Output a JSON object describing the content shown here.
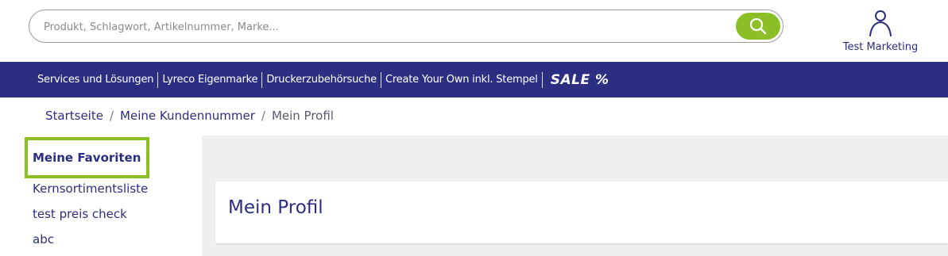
{
  "search": {
    "placeholder": "Produkt, Schlagwort, Artikelnummer, Marke...",
    "icon": "search-icon"
  },
  "user": {
    "name": "Test Marketing",
    "icon": "user-icon"
  },
  "nav": {
    "items": [
      {
        "label": "Services und Lösungen"
      },
      {
        "label": "Lyreco Eigenmarke"
      },
      {
        "label": "Druckerzubehörsuche"
      },
      {
        "label": "Create Your Own inkl. Stempel"
      }
    ],
    "sale_label": "SALE %"
  },
  "breadcrumb": {
    "items": [
      "Startseite",
      "Meine Kundennummer",
      "Mein Profil"
    ],
    "separator": "/"
  },
  "sidebar": {
    "active": "Meine Favoriten",
    "items": [
      "Kernsortimentsliste",
      "test preis check",
      "abc"
    ]
  },
  "main": {
    "title": "Mein Profil"
  },
  "colors": {
    "brand_blue": "#2c2e82",
    "accent_green": "#8cbf26",
    "text_blue": "#2b2e7e",
    "content_bg": "#efefef"
  }
}
